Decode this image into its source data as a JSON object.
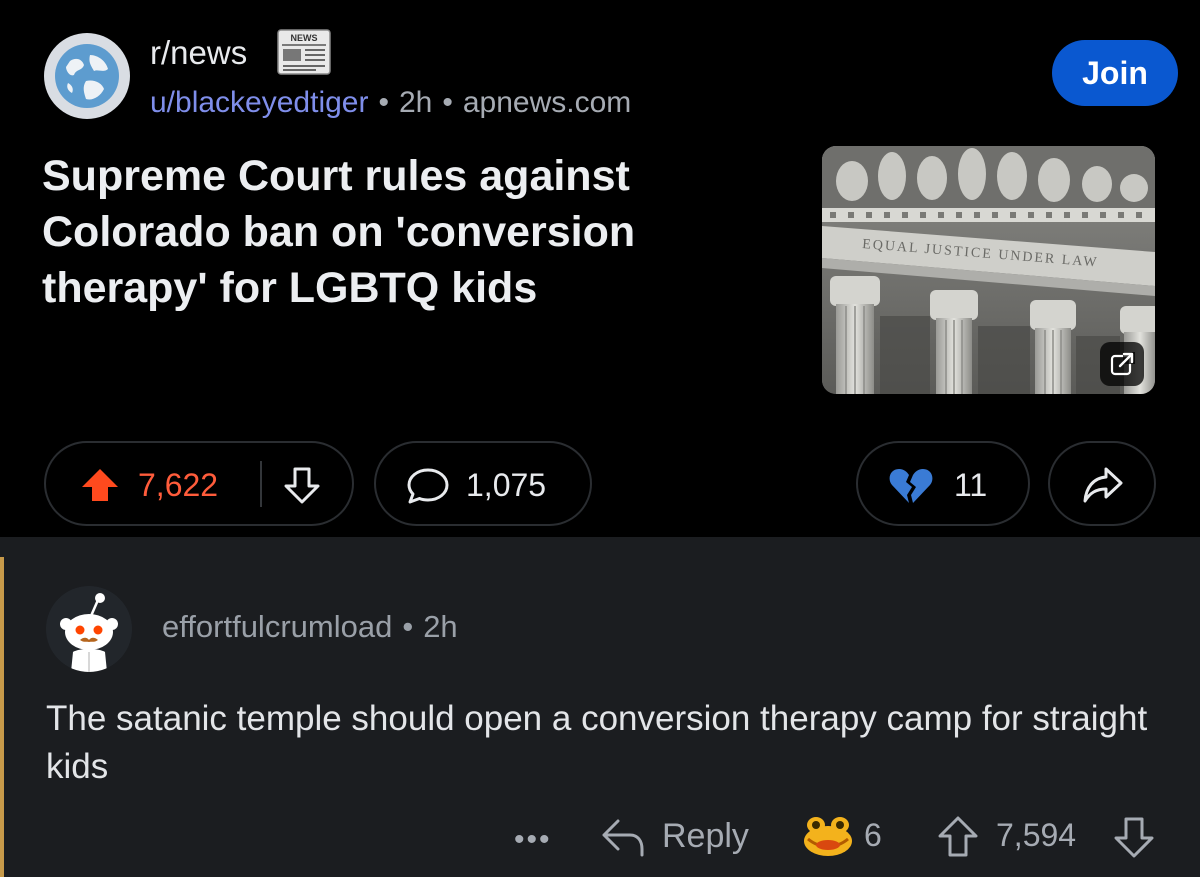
{
  "post": {
    "subreddit": "r/news",
    "author": "u/blackeyedtiger",
    "time": "2h",
    "domain": "apnews.com",
    "join_label": "Join",
    "title": "Supreme Court rules against Colorado ban on 'conversion therapy' for LGBTQ kids",
    "thumbnail_inscription": "EQUAL JUSTICE UNDER LAW",
    "news_icon_label": "NEWS",
    "score": "7,622",
    "comments": "1,075",
    "awards": "11"
  },
  "comment": {
    "author": "effortfulcrumload",
    "time": "2h",
    "body": "The satanic temple should open a conversion therapy camp for straight kids",
    "more_label": "•••",
    "reply_label": "Reply",
    "award_count": "6",
    "score": "7,594"
  },
  "icons": {
    "subreddit_avatar": "globe-icon",
    "news": "newspaper-icon",
    "upvote": "upvote-arrow-icon",
    "downvote": "downvote-arrow-icon",
    "comment": "speech-bubble-icon",
    "award": "broken-heart-icon",
    "share": "share-arrow-icon",
    "external": "external-link-icon",
    "reply": "reply-arrow-icon",
    "comment_award": "frog-award-icon"
  },
  "colors": {
    "background": "#000000",
    "comment_background": "#1b1d20",
    "join_button": "#0a58d0",
    "upvote_active": "#ff5c3b",
    "username_link": "#7f8eea",
    "accent_bar": "#c79a4a"
  }
}
